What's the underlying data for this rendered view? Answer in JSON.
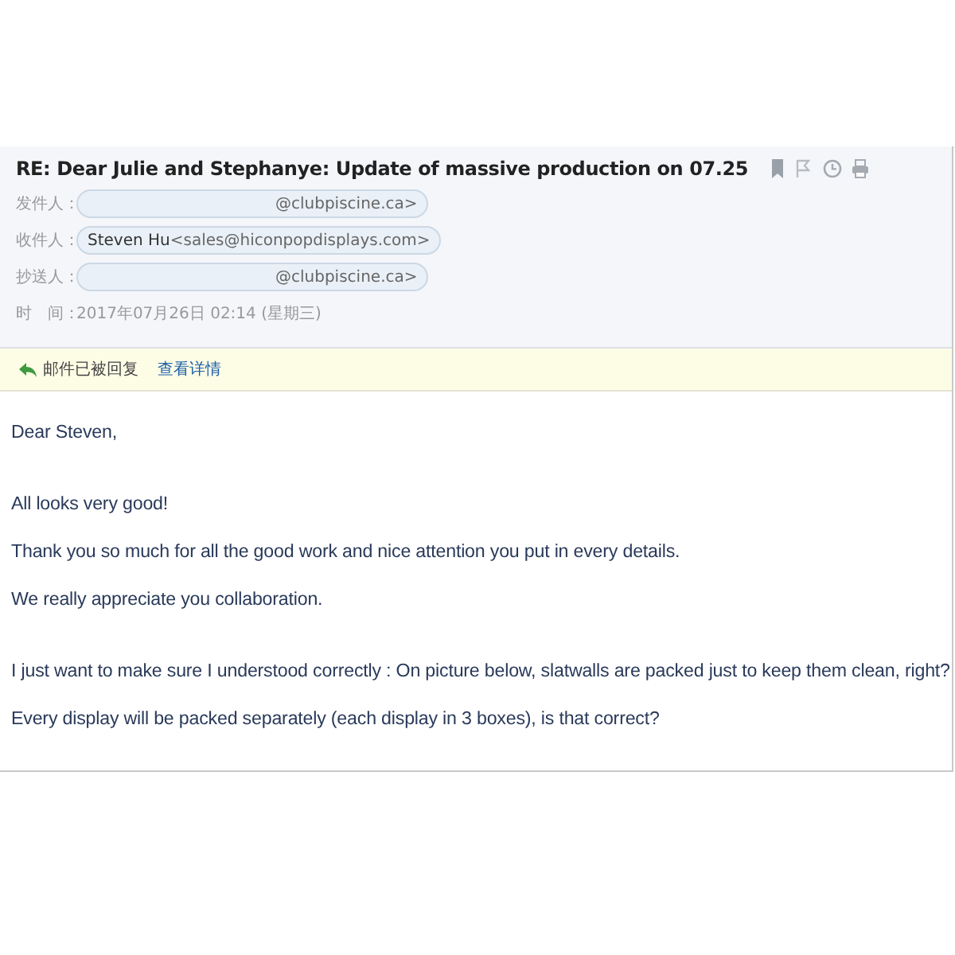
{
  "header": {
    "subject": "RE: Dear Julie and Stephanye: Update of massive production on 07.25",
    "fields": [
      {
        "label": "发件人：",
        "kind": "chip",
        "address": "@clubpiscine.ca>"
      },
      {
        "label": "收件人：",
        "kind": "chip",
        "name": "Steven Hu",
        "address": "<sales@hiconpopdisplays.com>"
      },
      {
        "label": "抄送人：",
        "kind": "chip",
        "address": "@clubpiscine.ca>"
      },
      {
        "label": "时　间：",
        "kind": "text",
        "value": "2017年07月26日 02:14 (星期三)"
      }
    ]
  },
  "notice": {
    "text": "邮件已被回复",
    "link": "查看详情"
  },
  "body": {
    "paragraph_groups": [
      [
        "Dear Steven,"
      ],
      [
        "All looks very good!",
        "Thank you so much for all the good work and nice attention you put in every details.",
        "We really appreciate you collaboration."
      ],
      [
        "I just want to make sure I understood correctly : On picture below, slatwalls are packed just to keep them clean, right?",
        "Every display will be packed separately (each display in 3 boxes), is that correct?"
      ]
    ]
  }
}
